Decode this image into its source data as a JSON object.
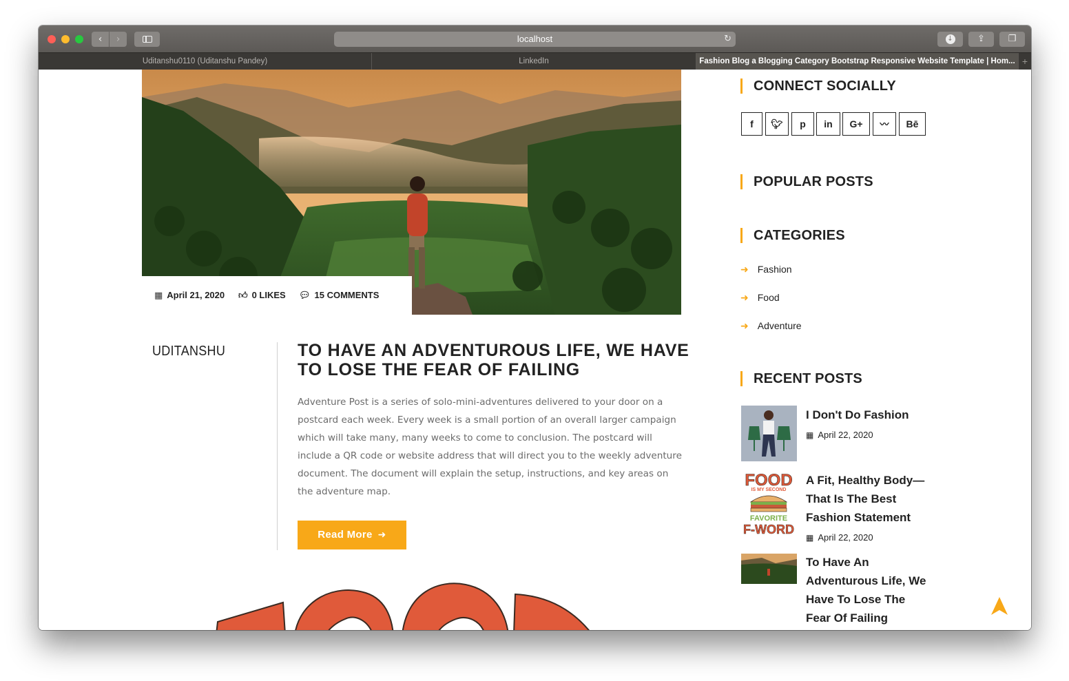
{
  "browser": {
    "url": "localhost",
    "tabs": [
      {
        "label": "Uditanshu0110 (Uditanshu Pandey)"
      },
      {
        "label": "LinkedIn"
      },
      {
        "label": "Fashion Blog a Blogging Category Bootstrap Responsive Website Template | Hom..."
      }
    ],
    "new_tab": "+",
    "icons": {
      "back": "chevron-left-icon",
      "forward": "chevron-right-icon",
      "sidebar": "sidebar-icon",
      "reload": "reload-icon",
      "download": "download-icon",
      "share": "share-icon",
      "tabs": "tabs-overview-icon"
    }
  },
  "post": {
    "meta": {
      "date": "April 21, 2020",
      "likes": "0 LIKES",
      "comments": "15 COMMENTS"
    },
    "author": "UDITANSHU",
    "title": "TO HAVE AN ADVENTUROUS LIFE, WE HAVE TO LOSE THE FEAR OF FAILING",
    "body": "Adventure Post is a series of solo-mini-adventures delivered to your door on a postcard each week. Every week is a small portion of an overall larger campaign which will take many, many weeks to come to conclusion. The postcard will include a QR code or website address that will direct you to the weekly adventure document. The document will explain the setup, instructions, and key areas on the adventure map.",
    "read_more": "Read More",
    "accent_color": "#f8a818"
  },
  "sidebar": {
    "connect_title": "CONNECT SOCIALLY",
    "social": [
      {
        "icon": "facebook-icon",
        "glyph": "f"
      },
      {
        "icon": "twitter-icon",
        "glyph": "t"
      },
      {
        "icon": "pinterest-icon",
        "glyph": "p"
      },
      {
        "icon": "linkedin-icon",
        "glyph": "in"
      },
      {
        "icon": "google-plus-icon",
        "glyph": "G+"
      },
      {
        "icon": "rss-icon",
        "glyph": "rss"
      },
      {
        "icon": "behance-icon",
        "glyph": "Bē"
      }
    ],
    "popular_title": "POPULAR POSTS",
    "categories_title": "CATEGORIES",
    "categories": [
      "Fashion",
      "Food",
      "Adventure"
    ],
    "recent_title": "RECENT POSTS",
    "recent": [
      {
        "title": "I Don't Do Fashion",
        "date": "April 22, 2020"
      },
      {
        "title": "A Fit, Healthy Body—That Is The Best Fashion Statement",
        "date": "April 22, 2020",
        "thumb_text": [
          "FOOD",
          "IS MY SECOND",
          "FAVORITE",
          "F-WORD"
        ]
      },
      {
        "title": "To Have An Adventurous Life, We Have To Lose The Fear Of Failing"
      }
    ]
  }
}
